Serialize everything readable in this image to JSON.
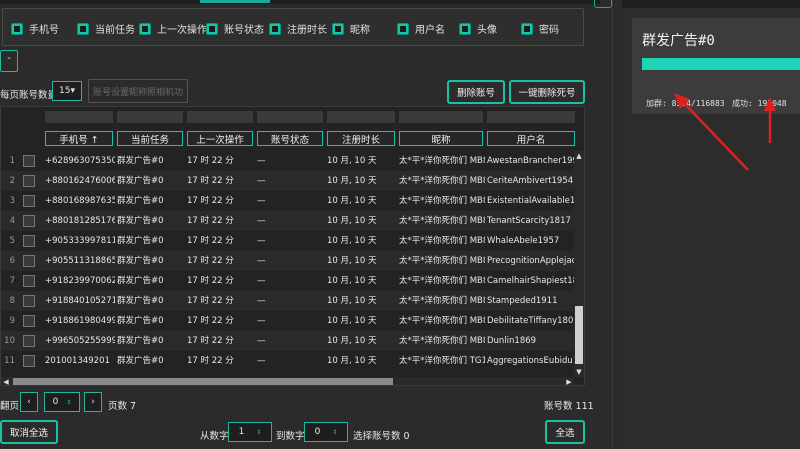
{
  "columns_panel": [
    {
      "label": "手机号"
    },
    {
      "label": "当前任务"
    },
    {
      "label": "上一次操作"
    },
    {
      "label": "账号状态"
    },
    {
      "label": "注册时长"
    },
    {
      "label": "昵称"
    },
    {
      "label": "用户名"
    },
    {
      "label": "头像"
    },
    {
      "label": "密码"
    }
  ],
  "small_button": "-",
  "page_size": {
    "label": "每页账号数量",
    "value": "15▾"
  },
  "disabled_button": "账号设置昵称照相机功",
  "buttons": {
    "delete_accounts": "删除账号",
    "delete_dead": "一键删除死号",
    "cancel_all": "取消全选",
    "select_all": "全选"
  },
  "table": {
    "headers": [
      "手机号 ↑",
      "当前任务",
      "上一次操作",
      "账号状态",
      "注册时长",
      "昵称",
      "用户名"
    ],
    "rows": [
      {
        "n": "1",
        "phone": "+6289630753504",
        "task": "群发广告#0",
        "last": "17 时 22 分",
        "status": "—",
        "dur": "10 月, 10 天",
        "nick": "太*平*洋你死你们 MB8",
        "user": "AwestanBrancher1998"
      },
      {
        "n": "2",
        "phone": "+8801624760063",
        "task": "群发广告#0",
        "last": "17 时 22 分",
        "status": "—",
        "dur": "10 月, 10 天",
        "nick": "太*平*洋你死你们 MB8",
        "user": "CeriteAmbivert1954"
      },
      {
        "n": "3",
        "phone": "+8801689876351",
        "task": "群发广告#0",
        "last": "17 时 22 分",
        "status": "—",
        "dur": "10 月, 10 天",
        "nick": "太*平*洋你死你们 MB8",
        "user": "ExistentialAvailable18"
      },
      {
        "n": "4",
        "phone": "+8801812851764",
        "task": "群发广告#0",
        "last": "17 时 22 分",
        "status": "—",
        "dur": "10 月, 10 天",
        "nick": "太*平*洋你死你们 MB8",
        "user": "TenantScarcity1817"
      },
      {
        "n": "5",
        "phone": "+905333997811",
        "task": "群发广告#0",
        "last": "17 时 22 分",
        "status": "—",
        "dur": "10 月, 10 天",
        "nick": "太*平*洋你死你们 MB8",
        "user": "WhaleAbele1957"
      },
      {
        "n": "6",
        "phone": "+905511318865",
        "task": "群发广告#0",
        "last": "17 时 22 分",
        "status": "—",
        "dur": "10 月, 10 天",
        "nick": "太*平*洋你死你们 MB8",
        "user": "PrecognitionApplejack2"
      },
      {
        "n": "7",
        "phone": "+918239970062",
        "task": "群发广告#0",
        "last": "17 时 22 分",
        "status": "—",
        "dur": "10 月, 10 天",
        "nick": "太*平*洋你死你们 MB8",
        "user": "CamelhairShapiest1847"
      },
      {
        "n": "8",
        "phone": "+918840105271",
        "task": "群发广告#0",
        "last": "17 时 22 分",
        "status": "—",
        "dur": "10 月, 10 天",
        "nick": "太*平*洋你死你们 MB8",
        "user": "Stampeded1911"
      },
      {
        "n": "9",
        "phone": "+918861980499",
        "task": "群发广告#0",
        "last": "17 时 22 分",
        "status": "—",
        "dur": "10 月, 10 天",
        "nick": "太*平*洋你死你们 MB8",
        "user": "DebilitateTiffany1806"
      },
      {
        "n": "10",
        "phone": "+996505255999",
        "task": "群发广告#0",
        "last": "17 时 22 分",
        "status": "—",
        "dur": "10 月, 10 天",
        "nick": "太*平*洋你死你们 MB8",
        "user": "Dunlin1869"
      },
      {
        "n": "11",
        "phone": "201001349201",
        "task": "群发广告#0",
        "last": "17 时 22 分",
        "status": "—",
        "dur": "10 月, 10 天",
        "nick": "太*平*洋你死你们 TG1",
        "user": "AggregationsEubidu1859"
      }
    ]
  },
  "pager": {
    "page_label": "翻页",
    "page_value": "0",
    "page_count_label": "页数 7",
    "account_count_label": "账号数 111",
    "from_label": "从数字",
    "from_value": "1",
    "to_label": "到数字",
    "to_value": "0",
    "selected_label": "选择账号数 0"
  },
  "task_card": {
    "title": "群发广告#0",
    "joined": "加群: 8554/116883",
    "success": "成功: 192048",
    "progress_fraction": 1.0
  },
  "colors": {
    "accent": "#18c2a6",
    "progress": "#20d3b7",
    "arrow": "#e02020"
  }
}
